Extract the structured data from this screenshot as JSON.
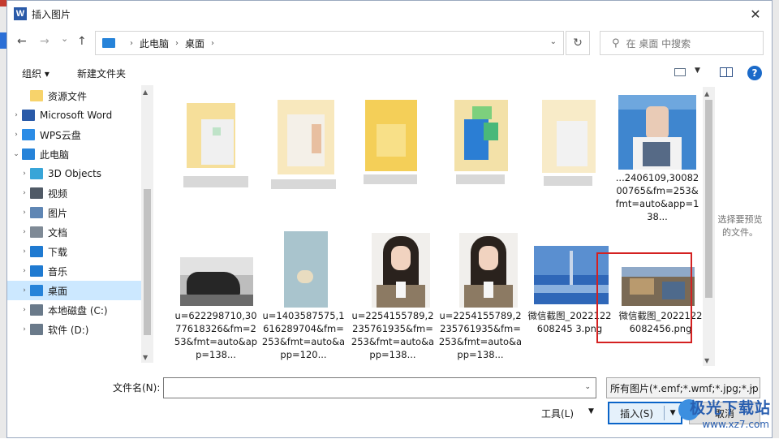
{
  "dialog": {
    "title": "插入图片",
    "app_icon_letter": "W",
    "close_glyph": "✕"
  },
  "nav": {
    "back": "←",
    "forward": "→",
    "history": "⌄",
    "up": "↑",
    "crumbs": [
      "此电脑",
      "桌面"
    ],
    "separator": "›",
    "refresh": "↻",
    "search_placeholder": "在 桌面 中搜索"
  },
  "toolbar": {
    "organize": "组织 ▾",
    "new_folder": "新建文件夹",
    "help": "?"
  },
  "sidebar": {
    "items": [
      {
        "label": "资源文件",
        "icon": "folder-icon",
        "color": "#f7d36b",
        "indent": 1,
        "chev": ""
      },
      {
        "label": "Microsoft Word",
        "icon": "word-icon",
        "color": "#2a5aa8",
        "indent": 0,
        "chev": "›"
      },
      {
        "label": "WPS云盘",
        "icon": "cloud-icon",
        "color": "#2b8ce6",
        "indent": 0,
        "chev": "›"
      },
      {
        "label": "此电脑",
        "icon": "computer-icon",
        "color": "#2683d9",
        "indent": 0,
        "chev": "⌄"
      },
      {
        "label": "3D Objects",
        "icon": "cube-icon",
        "color": "#38a5d8",
        "indent": 1,
        "chev": "›"
      },
      {
        "label": "视频",
        "icon": "video-icon",
        "color": "#505a66",
        "indent": 1,
        "chev": "›"
      },
      {
        "label": "图片",
        "icon": "pictures-icon",
        "color": "#5f86b4",
        "indent": 1,
        "chev": "›"
      },
      {
        "label": "文档",
        "icon": "documents-icon",
        "color": "#7f8a96",
        "indent": 1,
        "chev": "›"
      },
      {
        "label": "下载",
        "icon": "download-icon",
        "color": "#1f7ad1",
        "indent": 1,
        "chev": "›"
      },
      {
        "label": "音乐",
        "icon": "music-icon",
        "color": "#1f7ad1",
        "indent": 1,
        "chev": "›"
      },
      {
        "label": "桌面",
        "icon": "desktop-icon",
        "color": "#2683d9",
        "indent": 1,
        "chev": "›",
        "selected": true
      },
      {
        "label": "本地磁盘 (C:)",
        "icon": "drive-c-icon",
        "color": "#6a7a8a",
        "indent": 1,
        "chev": "›"
      },
      {
        "label": "软件 (D:)",
        "icon": "drive-d-icon",
        "color": "#6a7a8a",
        "indent": 1,
        "chev": "›"
      }
    ]
  },
  "files": {
    "row1_last_caption": "...2406109,3008200765&fm=253&fmt=auto&app=138...",
    "row2": [
      {
        "caption": "u=622298710,3077618326&fm=253&fmt=auto&app=138...",
        "kind": "rock"
      },
      {
        "caption": "u=1403587575,1616289704&fm=253&fmt=auto&app=120...",
        "kind": "duck"
      },
      {
        "caption": "u=2254155789,2235761935&fm=253&fmt=auto&app=138...",
        "kind": "girl"
      },
      {
        "caption": "u=2254155789,2235761935&fm=253&fmt=auto&app=138...",
        "kind": "girl"
      },
      {
        "caption": "微信截图_2022122608245 3.png",
        "kind": "bridge"
      },
      {
        "caption": "微信截图_20221226082456.png",
        "kind": "collage"
      }
    ]
  },
  "preview_text": "选择要预览的文件。",
  "bottom": {
    "filename_label": "文件名(N):",
    "filename_value": "",
    "filter_value": "所有图片(*.emf;*.wmf;*.jpg;*.jp",
    "tools": "工具(L)",
    "insert": "插入(S)",
    "cancel": "取消"
  },
  "watermark": {
    "title": "极光下载站",
    "url": "www.xz7.com"
  }
}
